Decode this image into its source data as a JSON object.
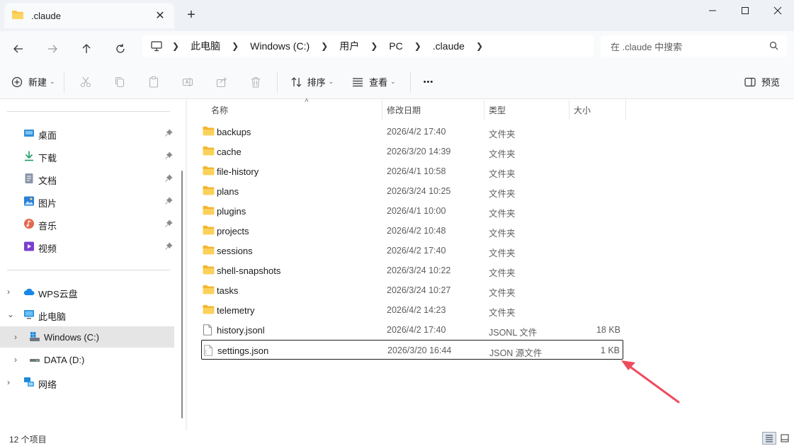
{
  "tab": {
    "title": ".claude",
    "close_icon": "close-icon",
    "new_tab": "+"
  },
  "window_controls": [
    "minimize",
    "maximize",
    "close"
  ],
  "breadcrumb": [
    "此电脑",
    "Windows (C:)",
    "用户",
    "PC",
    ".claude"
  ],
  "search": {
    "placeholder": "在 .claude 中搜索"
  },
  "toolbar": {
    "new_label": "新建",
    "sort_label": "排序",
    "view_label": "查看",
    "more_label": "•••",
    "preview_label": "预览"
  },
  "sidebar": {
    "quick_access": [
      {
        "label": "桌面",
        "icon": "desktop-icon"
      },
      {
        "label": "下载",
        "icon": "download-icon"
      },
      {
        "label": "文档",
        "icon": "document-icon"
      },
      {
        "label": "图片",
        "icon": "picture-icon"
      },
      {
        "label": "音乐",
        "icon": "music-icon"
      },
      {
        "label": "视频",
        "icon": "video-icon"
      }
    ],
    "tree": [
      {
        "label": "WPS云盘",
        "icon": "cloud-icon",
        "expanded": false
      },
      {
        "label": "此电脑",
        "icon": "computer-icon",
        "expanded": true
      },
      {
        "label": "Windows (C:)",
        "icon": "windows-drive-icon",
        "selected": true
      },
      {
        "label": "DATA (D:)",
        "icon": "drive-icon"
      },
      {
        "label": "网络",
        "icon": "network-icon"
      }
    ]
  },
  "columns": {
    "name": "名称",
    "modified": "修改日期",
    "type": "类型",
    "size": "大小"
  },
  "files": [
    {
      "name": "backups",
      "modified": "2026/4/2 17:40",
      "type": "文件夹",
      "size": "",
      "kind": "folder"
    },
    {
      "name": "cache",
      "modified": "2026/3/20 14:39",
      "type": "文件夹",
      "size": "",
      "kind": "folder"
    },
    {
      "name": "file-history",
      "modified": "2026/4/1 10:58",
      "type": "文件夹",
      "size": "",
      "kind": "folder"
    },
    {
      "name": "plans",
      "modified": "2026/3/24 10:25",
      "type": "文件夹",
      "size": "",
      "kind": "folder"
    },
    {
      "name": "plugins",
      "modified": "2026/4/1 10:00",
      "type": "文件夹",
      "size": "",
      "kind": "folder"
    },
    {
      "name": "projects",
      "modified": "2026/4/2 10:48",
      "type": "文件夹",
      "size": "",
      "kind": "folder"
    },
    {
      "name": "sessions",
      "modified": "2026/4/2 17:40",
      "type": "文件夹",
      "size": "",
      "kind": "folder"
    },
    {
      "name": "shell-snapshots",
      "modified": "2026/3/24 10:22",
      "type": "文件夹",
      "size": "",
      "kind": "folder"
    },
    {
      "name": "tasks",
      "modified": "2026/3/24 10:27",
      "type": "文件夹",
      "size": "",
      "kind": "folder"
    },
    {
      "name": "telemetry",
      "modified": "2026/4/2 14:23",
      "type": "文件夹",
      "size": "",
      "kind": "folder"
    },
    {
      "name": "history.jsonl",
      "modified": "2026/4/2 17:40",
      "type": "JSONL 文件",
      "size": "18 KB",
      "kind": "file"
    },
    {
      "name": "settings.json",
      "modified": "2026/3/20 16:44",
      "type": "JSON 源文件",
      "size": "1 KB",
      "kind": "json",
      "focused": true
    }
  ],
  "status": {
    "item_count": "12 个项目"
  },
  "colors": {
    "folder": "#f8c74a",
    "accent": "#0067c0",
    "annotation_arrow": "#ef4b5f"
  }
}
